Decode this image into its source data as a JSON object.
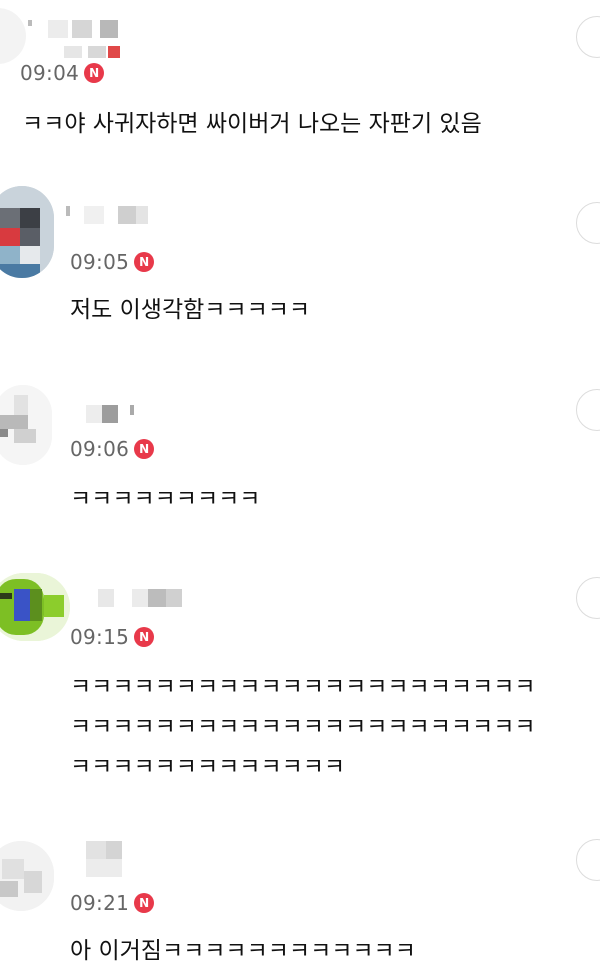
{
  "comments": [
    {
      "time": "09:04",
      "badge": "N",
      "text": "ㅋㅋ야 사귀자하면 싸이버거 나오는 자판기 있음"
    },
    {
      "time": "09:05",
      "badge": "N",
      "text": "저도 이생각함ㅋㅋㅋㅋㅋ"
    },
    {
      "time": "09:06",
      "badge": "N",
      "text": "ㅋㅋㅋㅋㅋㅋㅋㅋㅋ"
    },
    {
      "time": "09:15",
      "badge": "N",
      "lines": [
        "ㅋㅋㅋㅋㅋㅋㅋㅋㅋㅋㅋㅋㅋㅋㅋㅋㅋㅋㅋㅋㅋㅋ",
        "ㅋㅋㅋㅋㅋㅋㅋㅋㅋㅋㅋㅋㅋㅋㅋㅋㅋㅋㅋㅋㅋㅋ",
        "ㅋㅋㅋㅋㅋㅋㅋㅋㅋㅋㅋㅋㅋ"
      ]
    },
    {
      "time": "09:21",
      "badge": "N",
      "text": "아 이거짐ㅋㅋㅋㅋㅋㅋㅋㅋㅋㅋㅋㅋ"
    }
  ],
  "colors": {
    "badge": "#e8394a",
    "time": "#666666",
    "divider": "#e6e6e6"
  },
  "icons": {
    "badge": "new-badge-icon",
    "avatar": "profile-avatar",
    "more": "more-options-icon"
  }
}
